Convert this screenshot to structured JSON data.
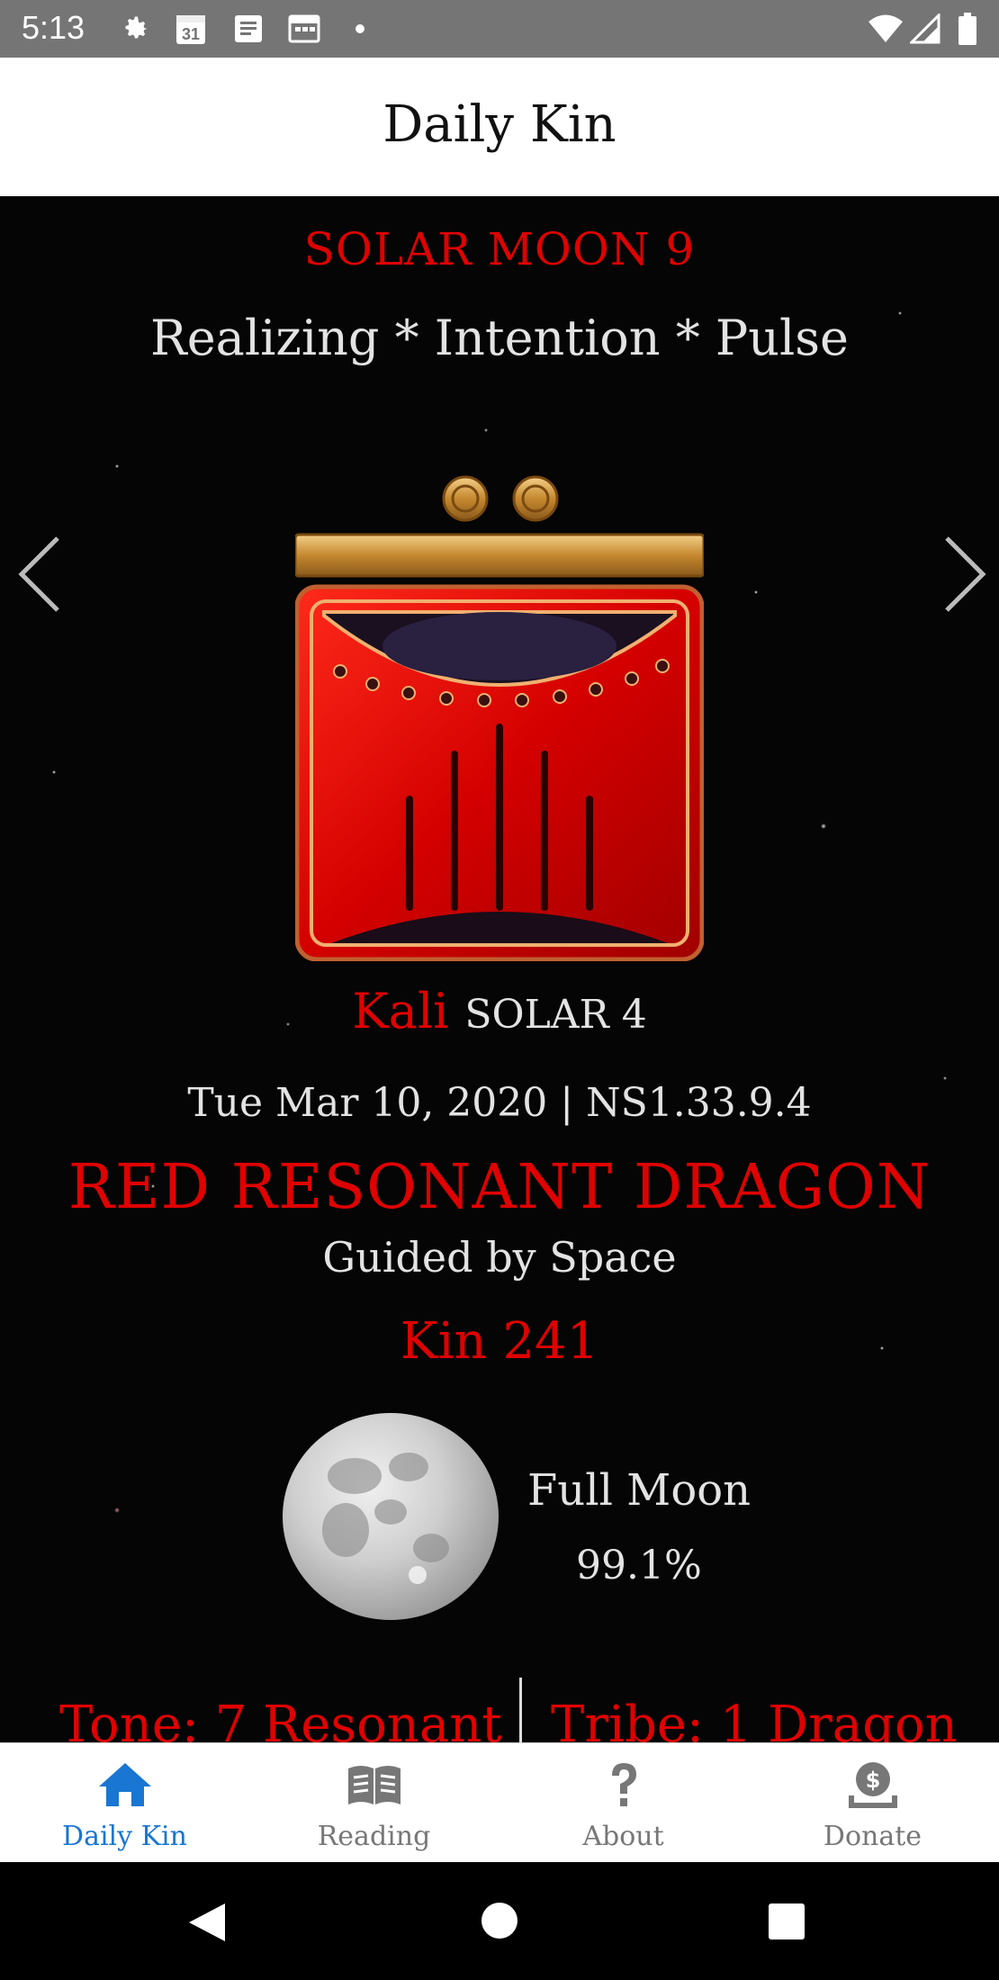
{
  "status_bar": {
    "time": "5:13",
    "left_icons": [
      "gear-icon",
      "calendar-31-icon",
      "document-icon",
      "calendar-grid-icon",
      "dot-icon"
    ],
    "right_icons": [
      "wifi-icon",
      "signal-icon",
      "battery-icon"
    ],
    "calendar_day": "31"
  },
  "app_bar": {
    "title": "Daily Kin"
  },
  "main": {
    "moon_heading": "SOLAR MOON 9",
    "affirmation": "Realizing * Intention * Pulse",
    "plasma_name": "Kali",
    "plasma_detail": "SOLAR 4",
    "date_line": "Tue Mar 10, 2020 | NS1.33.9.4",
    "kin_name": "RED RESONANT DRAGON",
    "guided_by": "Guided by Space",
    "kin_number": "Kin 241",
    "moon_phase": {
      "name": "Full Moon",
      "illumination": "99.1%"
    },
    "tone": "Tone: 7 Resonant",
    "tribe": "Tribe: 1 Dragon",
    "glyph_icon": "red-dragon-glyph-icon",
    "colors": {
      "accent_red": "#e00000",
      "text_light": "#e3e3e3",
      "gold": "#d4a04a"
    }
  },
  "bottom_nav": {
    "items": [
      {
        "label": "Daily Kin",
        "icon": "home-icon",
        "active": true
      },
      {
        "label": "Reading",
        "icon": "book-icon",
        "active": false
      },
      {
        "label": "About",
        "icon": "question-icon",
        "active": false
      },
      {
        "label": "Donate",
        "icon": "donate-icon",
        "active": false
      }
    ],
    "active_color": "#1976d2",
    "inactive_color": "#777777"
  },
  "system_nav": {
    "buttons": [
      "back-icon",
      "home-circle-icon",
      "recents-icon"
    ]
  }
}
